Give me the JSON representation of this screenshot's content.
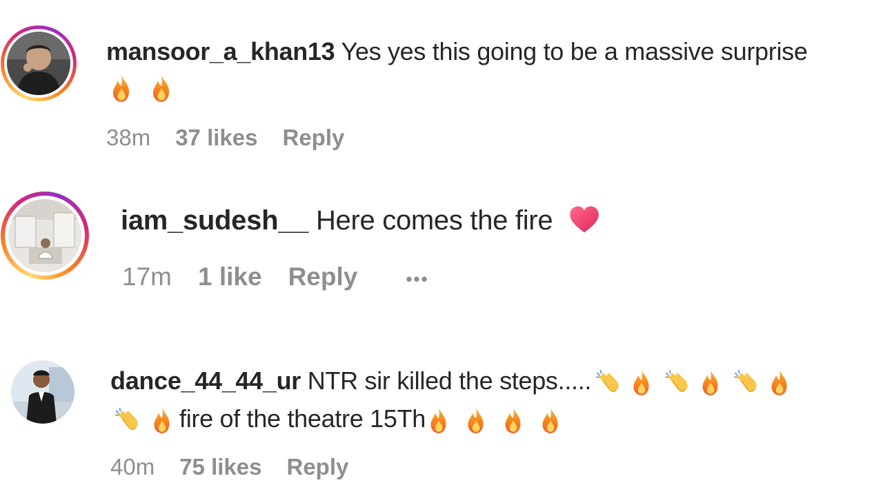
{
  "comments": [
    {
      "username": "mansoor_a_khan13",
      "text": "Yes yes this going to be a massive surprise",
      "emoji_line": [
        "fire-icon",
        "fire-icon"
      ],
      "time": "38m",
      "likes": "37 likes",
      "reply": "Reply",
      "story_ring": true
    },
    {
      "username": "iam_sudesh__",
      "text": "Here comes the fire",
      "trailing_emoji": "heart-icon",
      "time": "17m",
      "likes": "1 like",
      "reply": "Reply",
      "more": "•••",
      "story_ring": true
    },
    {
      "username": "dance_44_44_ur",
      "text": "NTR sir killed the steps.....",
      "line1_emojis": [
        "clap-icon",
        "fire-icon",
        "clap-icon",
        "fire-icon",
        "clap-icon",
        "fire-icon"
      ],
      "line2_prefix_emojis": [
        "clap-icon",
        "fire-icon"
      ],
      "line2_text": "fire of the theatre 15Th",
      "line2_suffix_emojis": [
        "fire-icon",
        "fire-icon",
        "fire-icon",
        "fire-icon"
      ],
      "time": "40m",
      "likes": "75 likes",
      "reply": "Reply",
      "story_ring": false
    }
  ],
  "colors": {
    "text": "#262626",
    "meta": "#8e8e8e",
    "background": "#ffffff",
    "heart": "#ed4956"
  }
}
